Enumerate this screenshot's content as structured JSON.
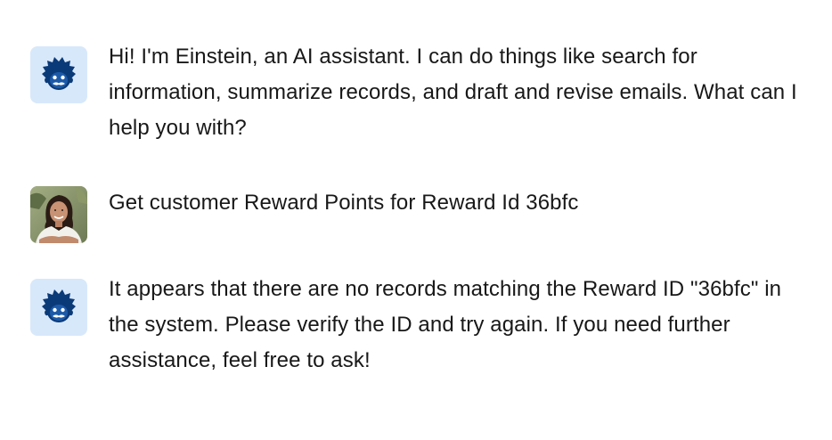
{
  "messages": [
    {
      "role": "assistant",
      "avatar_icon": "einstein-icon",
      "text": "Hi! I'm Einstein, an AI assistant. I can do things like search for information, summarize records, and draft and revise emails. What can I help you with?"
    },
    {
      "role": "user",
      "avatar_icon": "user-avatar",
      "text": "Get customer Reward Points for Reward Id 36bfc"
    },
    {
      "role": "assistant",
      "avatar_icon": "einstein-icon",
      "text": "It appears that there are no records matching the Reward ID \"36bfc\" in the system. Please verify the ID and try again. If you need further assistance, feel free to ask!"
    }
  ],
  "colors": {
    "bot_avatar_bg": "#d8e8fb",
    "einstein_blue": "#032d60",
    "text": "#181818"
  }
}
